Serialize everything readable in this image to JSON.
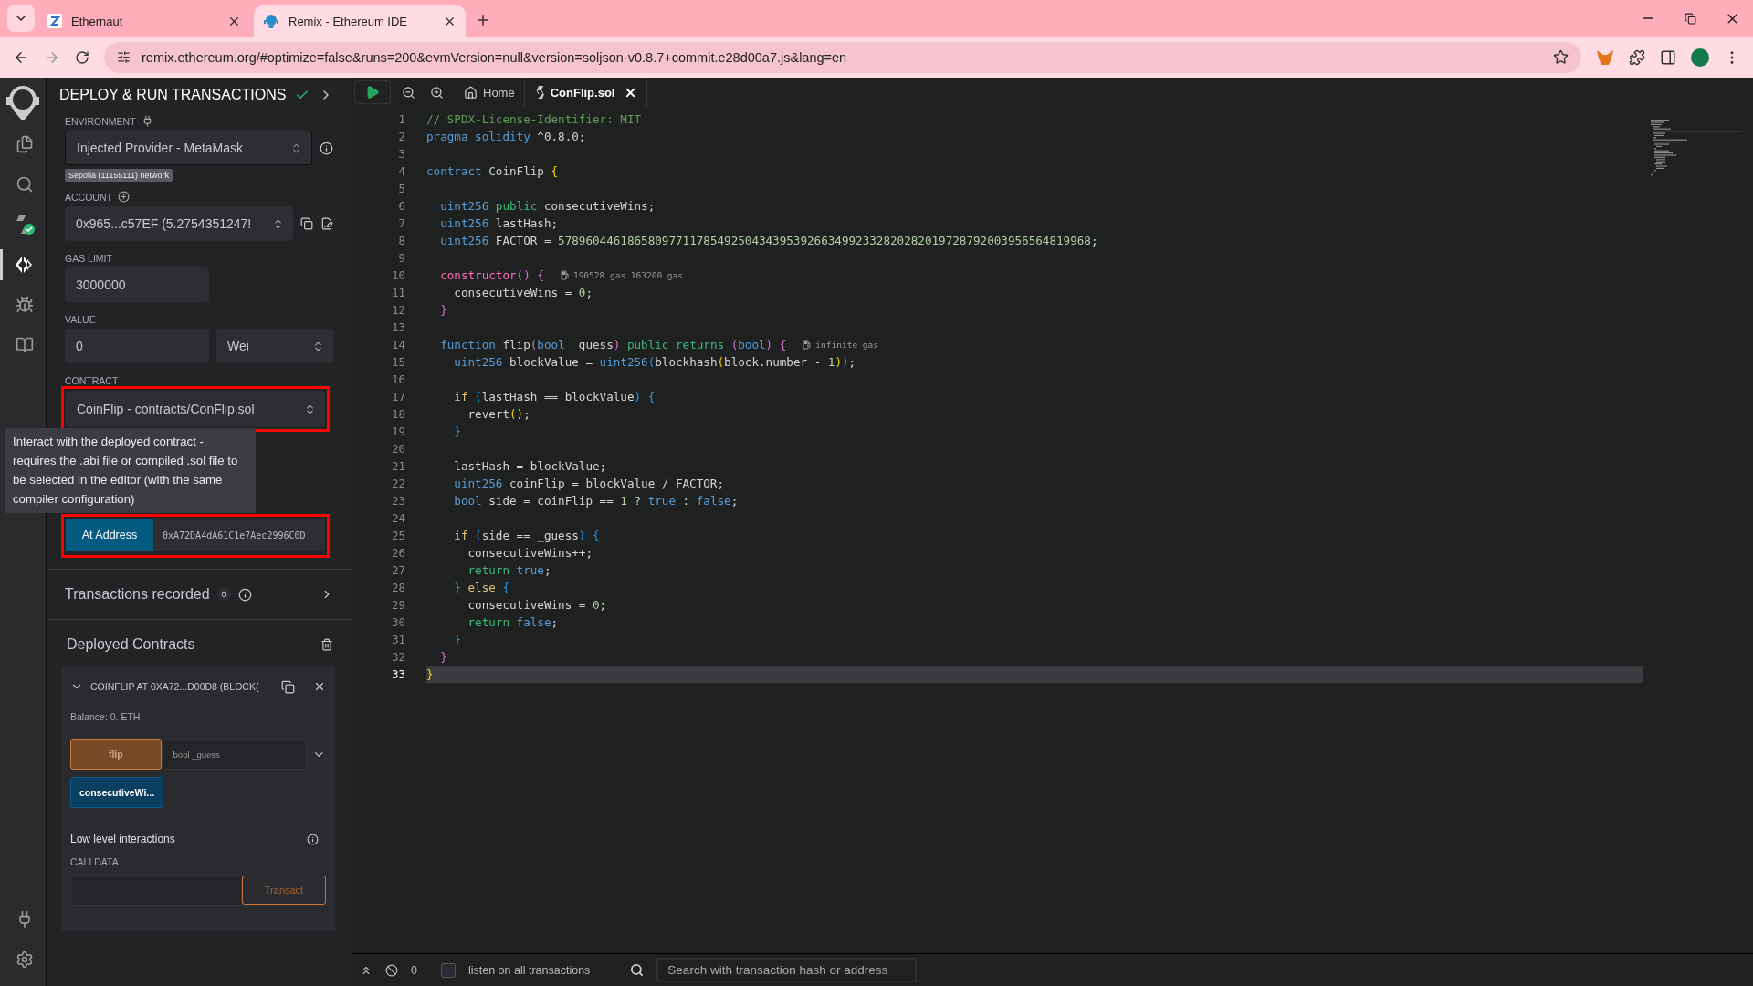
{
  "browser": {
    "tabs": [
      {
        "title": "Ethernaut",
        "kind": "ethernaut",
        "selected": false
      },
      {
        "title": "Remix - Ethereum IDE",
        "kind": "remix",
        "selected": true
      }
    ],
    "url": "remix.ethereum.org/#optimize=false&runs=200&evmVersion=null&version=soljson-v0.8.7+commit.e28d00a7.js&lang=en"
  },
  "icon_bar": [
    {
      "kind": "files",
      "selected": false
    },
    {
      "kind": "search",
      "selected": false
    },
    {
      "kind": "compiler",
      "selected": false
    },
    {
      "kind": "deploy",
      "selected": true
    },
    {
      "kind": "debugger",
      "selected": false
    },
    {
      "kind": "learn",
      "selected": false
    }
  ],
  "side_panel": {
    "title": "DEPLOY & RUN TRANSACTIONS",
    "environment": {
      "label": "ENVIRONMENT",
      "value": "Injected Provider - MetaMask",
      "network": "Sepolia (11155111) network"
    },
    "account": {
      "label": "ACCOUNT",
      "value": "0x965...c57EF (5.2754351247!"
    },
    "gas_limit": {
      "label": "GAS LIMIT",
      "value": "3000000"
    },
    "value": {
      "label": "VALUE",
      "amount": "0",
      "unit": "Wei"
    },
    "contract": {
      "label": "CONTRACT",
      "value": "CoinFlip - contracts/ConFlip.sol",
      "highlighted": true
    },
    "tooltip": "Interact with the deployed contract - requires the .abi file or compiled .sol file to be selected in the editor (with the same compiler configuration)",
    "at_address": {
      "button": "At Address",
      "value": "0xA72DA4dA61C1e7Aec2996C0D",
      "highlighted": true
    },
    "transactions_recorded": {
      "label": "Transactions recorded",
      "count": "0"
    },
    "deployed_contracts": {
      "title": "Deployed Contracts",
      "instance": {
        "title": "COINFLIP AT 0XA72...D00D8 (BLOCK(",
        "expanded": true,
        "balance": "Balance: 0. ETH",
        "functions": [
          {
            "kind": "transact",
            "label": "flip",
            "placeholder": "bool _guess"
          },
          {
            "kind": "call",
            "label": "consecutiveWi..."
          }
        ],
        "low_level": {
          "title": "Low level interactions",
          "calldata_label": "CALLDATA",
          "button": "Transact"
        }
      }
    }
  },
  "editor": {
    "tabs": [
      {
        "kind": "home",
        "label": "Home",
        "selected": false
      },
      {
        "kind": "file",
        "label": "ConFlip.sol",
        "selected": true
      }
    ],
    "lines": [
      {
        "number": "1",
        "active": false,
        "tokens": [
          {
            "kind": "comment",
            "text": "// SPDX-License-Identifier: MIT"
          }
        ]
      },
      {
        "number": "2",
        "active": false,
        "tokens": [
          {
            "kind": "type",
            "text": "pragma solidity"
          },
          {
            "kind": "plain",
            "text": " ^0.8.0;"
          }
        ]
      },
      {
        "number": "3",
        "active": false
      },
      {
        "number": "4",
        "active": false,
        "tokens": [
          {
            "kind": "type",
            "text": "contract"
          },
          {
            "kind": "plain",
            "text": " CoinFlip "
          },
          {
            "kind": "brace1",
            "text": "{"
          }
        ]
      },
      {
        "number": "5",
        "active": false
      },
      {
        "number": "6",
        "active": false,
        "tokens": [
          {
            "kind": "type",
            "text": "  uint256 "
          },
          {
            "kind": "modifier",
            "text": "public"
          },
          {
            "kind": "plain",
            "text": " consecutiveWins;"
          }
        ]
      },
      {
        "number": "7",
        "active": false,
        "tokens": [
          {
            "kind": "type",
            "text": "  uint256"
          },
          {
            "kind": "plain",
            "text": " lastHash;"
          }
        ]
      },
      {
        "number": "8",
        "active": false,
        "tokens": [
          {
            "kind": "type",
            "text": "  uint256"
          },
          {
            "kind": "plain",
            "text": " FACTOR = "
          },
          {
            "kind": "number",
            "text": "57896044618658097711785492504343953926634992332820282019728792003956564819968"
          },
          {
            "kind": "plain",
            "text": ";"
          }
        ]
      },
      {
        "number": "9",
        "active": false
      },
      {
        "number": "10",
        "active": false,
        "hint": "190528 gas 163200 gas",
        "tokens": [
          {
            "kind": "special",
            "text": "  constructor"
          },
          {
            "kind": "brace2",
            "text": "() {"
          }
        ]
      },
      {
        "number": "11",
        "active": false,
        "tokens": [
          {
            "kind": "plain",
            "text": "    consecutiveWins = "
          },
          {
            "kind": "number",
            "text": "0"
          },
          {
            "kind": "plain",
            "text": ";"
          }
        ]
      },
      {
        "number": "12",
        "active": false,
        "tokens": [
          {
            "kind": "brace2",
            "text": "  }"
          }
        ]
      },
      {
        "number": "13",
        "active": false
      },
      {
        "number": "14",
        "active": false,
        "hint": "infinite gas",
        "tokens": [
          {
            "kind": "type",
            "text": "  function"
          },
          {
            "kind": "plain",
            "text": " flip"
          },
          {
            "kind": "brace2",
            "text": "("
          },
          {
            "kind": "type",
            "text": "bool"
          },
          {
            "kind": "plain",
            "text": " _guess"
          },
          {
            "kind": "brace2",
            "text": ") "
          },
          {
            "kind": "modifier",
            "text": "public returns "
          },
          {
            "kind": "brace2",
            "text": "("
          },
          {
            "kind": "type",
            "text": "bool"
          },
          {
            "kind": "brace2",
            "text": ") {"
          }
        ]
      },
      {
        "number": "15",
        "active": false,
        "tokens": [
          {
            "kind": "type",
            "text": "    uint256"
          },
          {
            "kind": "plain",
            "text": " blockValue = "
          },
          {
            "kind": "type",
            "text": "uint256"
          },
          {
            "kind": "brace3",
            "text": "("
          },
          {
            "kind": "plain",
            "text": "blockhash"
          },
          {
            "kind": "brace1",
            "text": "("
          },
          {
            "kind": "plain",
            "text": "block.number - "
          },
          {
            "kind": "number",
            "text": "1"
          },
          {
            "kind": "brace1",
            "text": ")"
          },
          {
            "kind": "brace3",
            "text": ")"
          },
          {
            "kind": "plain",
            "text": ";"
          }
        ]
      },
      {
        "number": "16",
        "active": false
      },
      {
        "number": "17",
        "active": false,
        "tokens": [
          {
            "kind": "control",
            "text": "    if "
          },
          {
            "kind": "brace3",
            "text": "("
          },
          {
            "kind": "plain",
            "text": "lastHash == blockValue"
          },
          {
            "kind": "brace3",
            "text": ") {"
          }
        ]
      },
      {
        "number": "18",
        "active": false,
        "tokens": [
          {
            "kind": "plain",
            "text": "      revert"
          },
          {
            "kind": "brace1",
            "text": "()"
          },
          {
            "kind": "plain",
            "text": ";"
          }
        ]
      },
      {
        "number": "19",
        "active": false,
        "tokens": [
          {
            "kind": "brace3",
            "text": "    }"
          }
        ]
      },
      {
        "number": "20",
        "active": false
      },
      {
        "number": "21",
        "active": false,
        "tokens": [
          {
            "kind": "plain",
            "text": "    lastHash = blockValue;"
          }
        ]
      },
      {
        "number": "22",
        "active": false,
        "tokens": [
          {
            "kind": "type",
            "text": "    uint256"
          },
          {
            "kind": "plain",
            "text": " coinFlip = blockValue / FACTOR;"
          }
        ]
      },
      {
        "number": "23",
        "active": false,
        "tokens": [
          {
            "kind": "type",
            "text": "    bool"
          },
          {
            "kind": "plain",
            "text": " side = coinFlip == "
          },
          {
            "kind": "number",
            "text": "1"
          },
          {
            "kind": "plain",
            "text": " ? "
          },
          {
            "kind": "type",
            "text": "true"
          },
          {
            "kind": "plain",
            "text": " : "
          },
          {
            "kind": "type",
            "text": "false"
          },
          {
            "kind": "plain",
            "text": ";"
          }
        ]
      },
      {
        "number": "24",
        "active": false
      },
      {
        "number": "25",
        "active": false,
        "tokens": [
          {
            "kind": "control",
            "text": "    if "
          },
          {
            "kind": "brace3",
            "text": "("
          },
          {
            "kind": "plain",
            "text": "side == _guess"
          },
          {
            "kind": "brace3",
            "text": ") {"
          }
        ]
      },
      {
        "number": "26",
        "active": false,
        "tokens": [
          {
            "kind": "plain",
            "text": "      consecutiveWins++;"
          }
        ]
      },
      {
        "number": "27",
        "active": false,
        "tokens": [
          {
            "kind": "modifier",
            "text": "      return "
          },
          {
            "kind": "type",
            "text": "true"
          },
          {
            "kind": "plain",
            "text": ";"
          }
        ]
      },
      {
        "number": "28",
        "active": false,
        "tokens": [
          {
            "kind": "brace3",
            "text": "    } "
          },
          {
            "kind": "control",
            "text": "else "
          },
          {
            "kind": "brace3",
            "text": "{"
          }
        ]
      },
      {
        "number": "29",
        "active": false,
        "tokens": [
          {
            "kind": "plain",
            "text": "      consecutiveWins = "
          },
          {
            "kind": "number",
            "text": "0"
          },
          {
            "kind": "plain",
            "text": ";"
          }
        ]
      },
      {
        "number": "30",
        "active": false,
        "tokens": [
          {
            "kind": "modifier",
            "text": "      return "
          },
          {
            "kind": "type",
            "text": "false"
          },
          {
            "kind": "plain",
            "text": ";"
          }
        ]
      },
      {
        "number": "31",
        "active": false,
        "tokens": [
          {
            "kind": "brace3",
            "text": "    }"
          }
        ]
      },
      {
        "number": "32",
        "active": false,
        "tokens": [
          {
            "kind": "brace2",
            "text": "  }"
          }
        ]
      },
      {
        "number": "33",
        "active": true,
        "tokens": [
          {
            "kind": "brace1",
            "text": "}"
          }
        ]
      }
    ]
  },
  "status_bar": {
    "count": "0",
    "listen": {
      "label": "listen on all transactions",
      "checked": false
    },
    "search_placeholder": "Search with transaction hash or address"
  }
}
